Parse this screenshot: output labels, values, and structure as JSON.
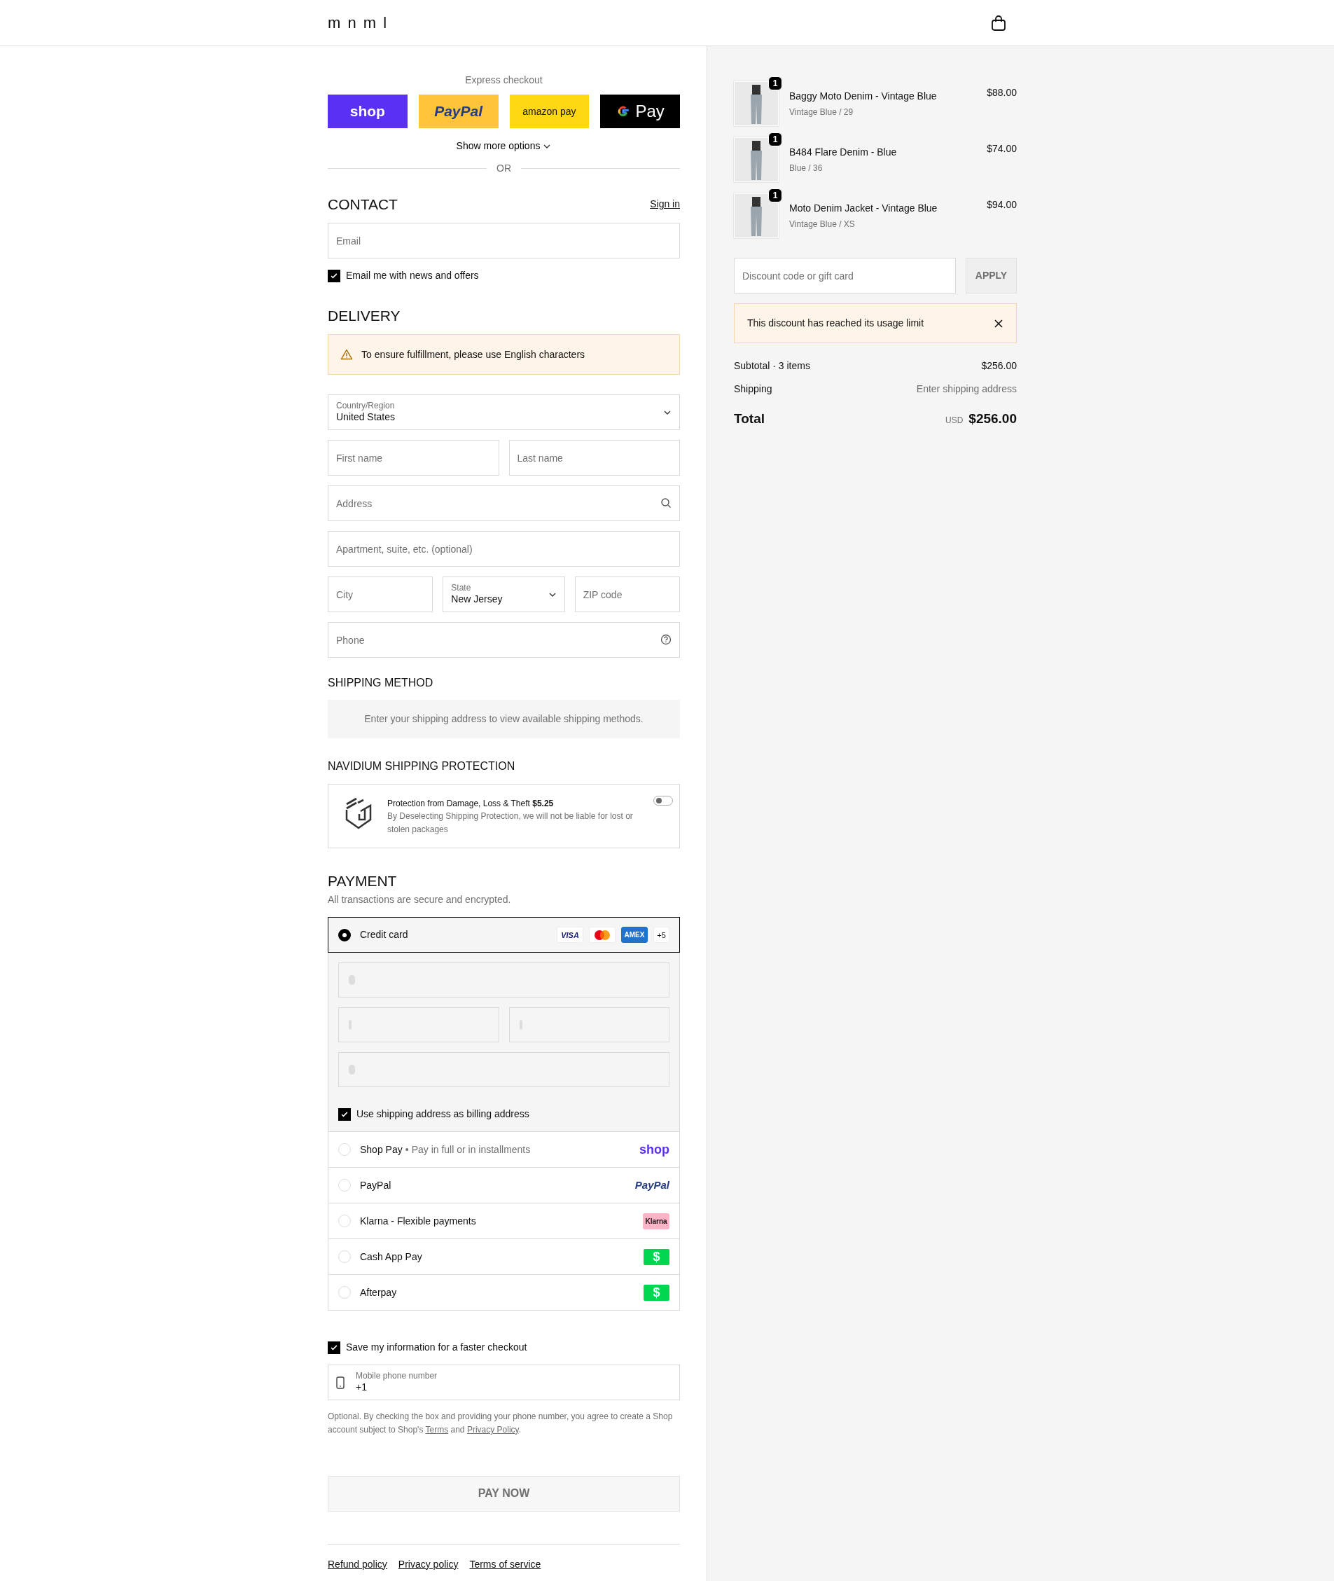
{
  "header": {
    "logo": "m n m l"
  },
  "express": {
    "label": "Express checkout",
    "buttons": [
      {
        "kind": "shop",
        "label": "shop"
      },
      {
        "kind": "paypal",
        "label": "PayPal"
      },
      {
        "kind": "amazon",
        "label": "amazon pay"
      },
      {
        "kind": "gpay",
        "label": "Pay"
      }
    ],
    "show_more": "Show more options",
    "or": "OR"
  },
  "contact": {
    "title": "CONTACT",
    "sign_in": "Sign in",
    "email_placeholder": "Email",
    "news": {
      "label": "Email me with news and offers",
      "checked": true
    }
  },
  "delivery": {
    "title": "DELIVERY",
    "notice": "To ensure fulfillment, please use English characters",
    "rows": [
      [
        {
          "kind": "select",
          "label": "Country/Region",
          "value": "United States"
        }
      ],
      [
        {
          "kind": "text",
          "placeholder": "First name"
        },
        {
          "kind": "text",
          "placeholder": "Last name"
        }
      ],
      [
        {
          "kind": "search",
          "placeholder": "Address"
        }
      ],
      [
        {
          "kind": "text",
          "placeholder": "Apartment, suite, etc. (optional)"
        }
      ],
      [
        {
          "kind": "text",
          "placeholder": "City"
        },
        {
          "kind": "select",
          "label": "State",
          "value": "New Jersey"
        },
        {
          "kind": "text",
          "placeholder": "ZIP code"
        }
      ],
      [
        {
          "kind": "help",
          "placeholder": "Phone"
        }
      ]
    ]
  },
  "shipping_method": {
    "title": "SHIPPING METHOD",
    "message": "Enter your shipping address to view available shipping methods."
  },
  "protection": {
    "title": "NAVIDIUM SHIPPING PROTECTION",
    "heading": "Protection from Damage, Loss & Theft **$5.25**",
    "note": "By Deselecting Shipping Protection, we will not be liable for lost or stolen packages",
    "on": false
  },
  "payment": {
    "title": "PAYMENT",
    "subtitle": "All transactions are secure and encrypted.",
    "billing": {
      "label": "Use shipping address as billing address",
      "checked": true
    },
    "methods": [
      {
        "kind": "card",
        "label": "Credit card",
        "selected": true,
        "badges": [
          "VISA",
          "AMEX",
          "+5"
        ]
      },
      {
        "kind": "shop",
        "label": "Shop Pay",
        "separator": "•",
        "note": "Pay in full or in installments",
        "logo": "shop",
        "selected": false
      },
      {
        "kind": "paypal",
        "label": "PayPal",
        "logo": "PayPal",
        "selected": false
      },
      {
        "kind": "klarna",
        "label": "Klarna - Flexible payments",
        "logo": "Klarna",
        "selected": false
      },
      {
        "kind": "cash",
        "label": "Cash App Pay",
        "logo": "$",
        "selected": false
      },
      {
        "kind": "cash",
        "label": "Afterpay",
        "logo": "$",
        "selected": false
      }
    ]
  },
  "save": {
    "label": "Save my information for a faster checkout",
    "checked": true,
    "phone_label": "Mobile phone number",
    "phone_value": "+1",
    "disclaimer": {
      "before": "Optional. By checking the box and providing your phone number, you agree to create a Shop account subject to Shop's ",
      "terms": "Terms",
      "middle": " and ",
      "privacy": "Privacy Policy",
      "after": "."
    }
  },
  "pay_button": "PAY NOW",
  "footer_links": [
    "Refund policy",
    "Privacy policy",
    "Terms of service"
  ],
  "summary": {
    "items": [
      {
        "name": "Baggy Moto Denim - Vintage Blue",
        "variant": "Vintage Blue / 29",
        "price": "$88.00",
        "quantity": "1"
      },
      {
        "name": "B484 Flare Denim - Blue",
        "variant": "Blue / 36",
        "price": "$74.00",
        "quantity": "1"
      },
      {
        "name": "Moto Denim Jacket - Vintage Blue",
        "variant": "Vintage Blue / XS",
        "price": "$94.00",
        "quantity": "1"
      }
    ],
    "discount_placeholder": "Discount code or gift card",
    "apply": "APPLY",
    "error": "This discount has reached its usage limit",
    "subtotal_label": "Subtotal · 3 items",
    "subtotal": "$256.00",
    "shipping_label": "Shipping",
    "shipping": "Enter shipping address",
    "total_label": "Total",
    "currency": "USD",
    "total": "$256.00"
  }
}
